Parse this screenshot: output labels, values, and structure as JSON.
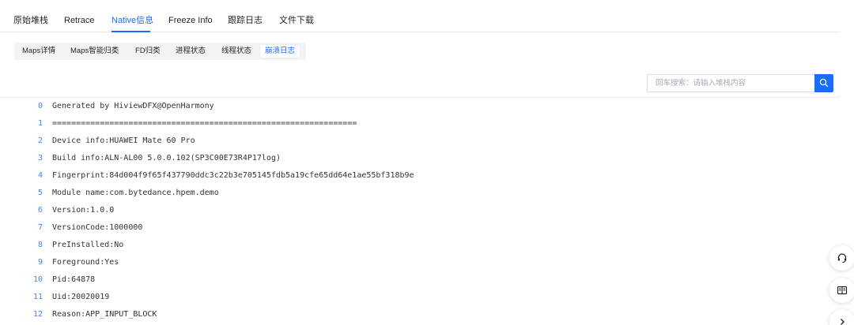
{
  "main_tabs": [
    {
      "label": "原始堆栈",
      "active": false
    },
    {
      "label": "Retrace",
      "active": false
    },
    {
      "label": "Native信息",
      "active": true
    },
    {
      "label": "Freeze Info",
      "active": false
    },
    {
      "label": "跟踪日志",
      "active": false
    },
    {
      "label": "文件下载",
      "active": false
    }
  ],
  "sub_tabs": [
    {
      "label": "Maps详情",
      "active": false
    },
    {
      "label": "Maps智能归类",
      "active": false
    },
    {
      "label": "FD归类",
      "active": false
    },
    {
      "label": "进程状态",
      "active": false
    },
    {
      "label": "线程状态",
      "active": false
    },
    {
      "label": "崩溃日志",
      "active": true
    }
  ],
  "search": {
    "placeholder": "回车搜索：请输入堆栈内容",
    "value": ""
  },
  "log_lines": [
    {
      "num": "0",
      "text": "Generated by HiviewDFX@OpenHarmony"
    },
    {
      "num": "1",
      "text": "================================================================"
    },
    {
      "num": "2",
      "text": "Device info:HUAWEI Mate 60 Pro"
    },
    {
      "num": "3",
      "text": "Build info:ALN-AL00 5.0.0.102(SP3C00E73R4P17log)"
    },
    {
      "num": "4",
      "text": "Fingerprint:84d004f9f65f437790ddc3c22b3e705145fdb5a19cfe65dd64e1ae55bf318b9e"
    },
    {
      "num": "5",
      "text": "Module name:com.bytedance.hpem.demo"
    },
    {
      "num": "6",
      "text": "Version:1.0.0"
    },
    {
      "num": "7",
      "text": "VersionCode:1000000"
    },
    {
      "num": "8",
      "text": "PreInstalled:No"
    },
    {
      "num": "9",
      "text": "Foreground:Yes"
    },
    {
      "num": "10",
      "text": "Pid:64878"
    },
    {
      "num": "11",
      "text": "Uid:20020019"
    },
    {
      "num": "12",
      "text": "Reason:APP_INPUT_BLOCK"
    }
  ],
  "colors": {
    "accent": "#1a6cff",
    "line_number": "#4a86e8",
    "text": "#333333"
  },
  "float_buttons": [
    {
      "icon": "headset-icon"
    },
    {
      "icon": "book-icon"
    },
    {
      "icon": "chevron-right-icon"
    }
  ]
}
